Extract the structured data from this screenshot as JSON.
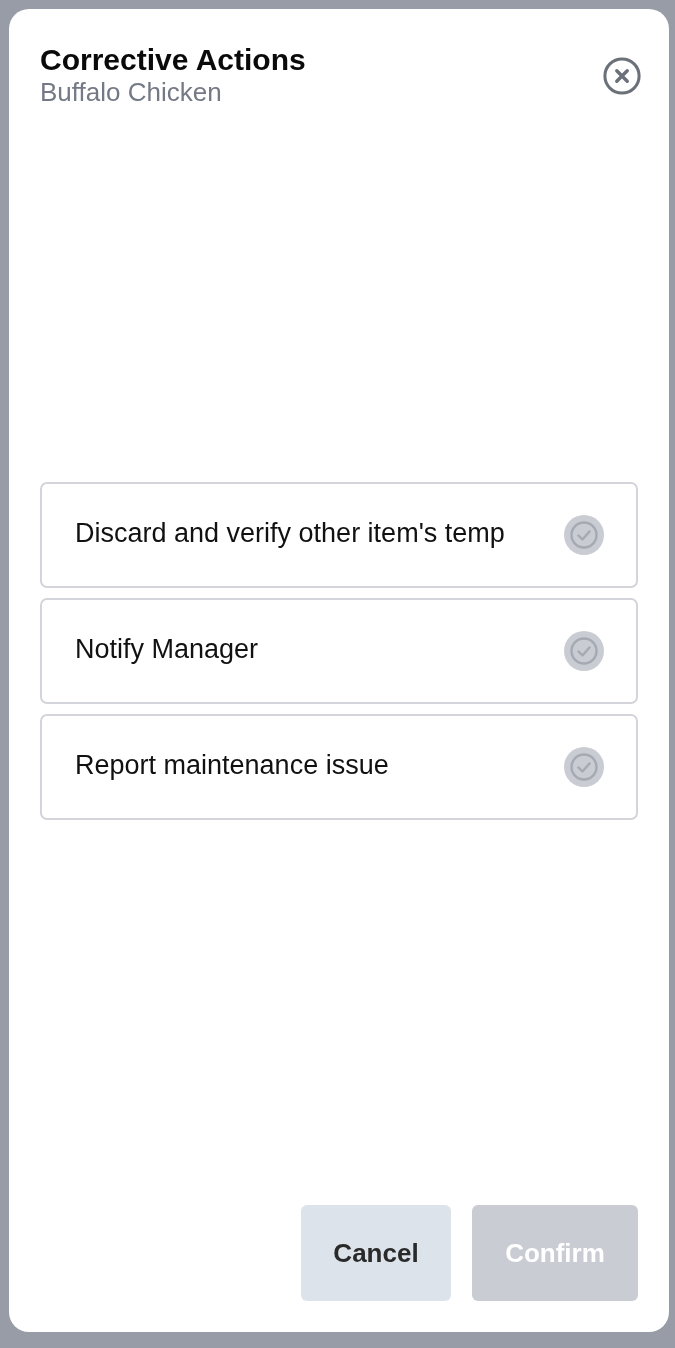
{
  "dialog": {
    "title": "Corrective Actions",
    "subtitle": "Buffalo Chicken"
  },
  "options": [
    {
      "label": "Discard and verify other item's temp",
      "selected": false
    },
    {
      "label": "Notify Manager",
      "selected": false
    },
    {
      "label": "Report maintenance issue",
      "selected": false
    }
  ],
  "buttons": [
    {
      "label": "Cancel",
      "kind": "secondary",
      "disabled": false
    },
    {
      "label": "Confirm",
      "kind": "primary",
      "disabled": true
    }
  ]
}
